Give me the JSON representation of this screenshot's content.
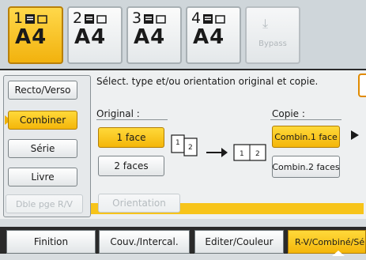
{
  "trays": [
    {
      "number": "1",
      "paper": "A4",
      "selected": true
    },
    {
      "number": "2",
      "paper": "A4",
      "selected": false
    },
    {
      "number": "3",
      "paper": "A4",
      "selected": false
    },
    {
      "number": "4",
      "paper": "A4",
      "selected": false
    }
  ],
  "bypass": {
    "label": "Bypass"
  },
  "left_menu": {
    "recto_verso": "Recto/Verso",
    "combiner": "Combiner",
    "serie": "Série",
    "livre": "Livre",
    "dble_pge": "Dble pge R/V"
  },
  "instruction": "Sélect. type et/ou orientation original et copie.",
  "original": {
    "label": "Original :",
    "one_face": "1 face",
    "two_faces": "2 faces",
    "orientation": "Orientation"
  },
  "copie": {
    "label": "Copie :",
    "combin1": "Combin.1 face",
    "combin2": "Combin.2 faces"
  },
  "diagram": {
    "page1": "1",
    "page2": "2",
    "out1": "1",
    "out2": "2"
  },
  "tabs": {
    "finition": "Finition",
    "couv": "Couv./Intercal.",
    "editer": "Editer/Couleur",
    "rv": "R-V/Combiné/Sér"
  },
  "colors": {
    "accent": "#f4b60a",
    "rail": "#2a2a2a"
  }
}
